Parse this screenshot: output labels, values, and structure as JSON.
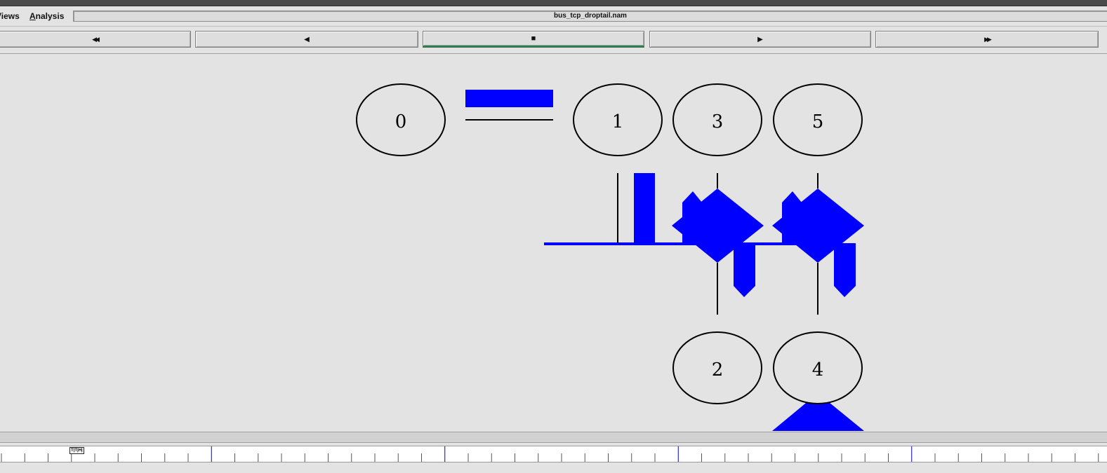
{
  "menu": {
    "views_label": "Views",
    "analysis_label": "Analysis"
  },
  "file": {
    "name": "bus_tcp_droptail.nam"
  },
  "toolbar": {
    "rewind_icon": "◀◀",
    "back_icon": "◀",
    "stop_icon": "■",
    "play_icon": "▶",
    "fastforward_icon": "▶▶"
  },
  "nodes": {
    "n0": "0",
    "n1": "1",
    "n2": "2",
    "n3": "3",
    "n4": "4",
    "n5": "5"
  },
  "colors": {
    "packet": "#0000ff",
    "link": "#000000",
    "background": "#e3e3e3",
    "timeline_major_tick": "#0000cc"
  },
  "timeline": {
    "marker_label": "T|T|H|"
  }
}
